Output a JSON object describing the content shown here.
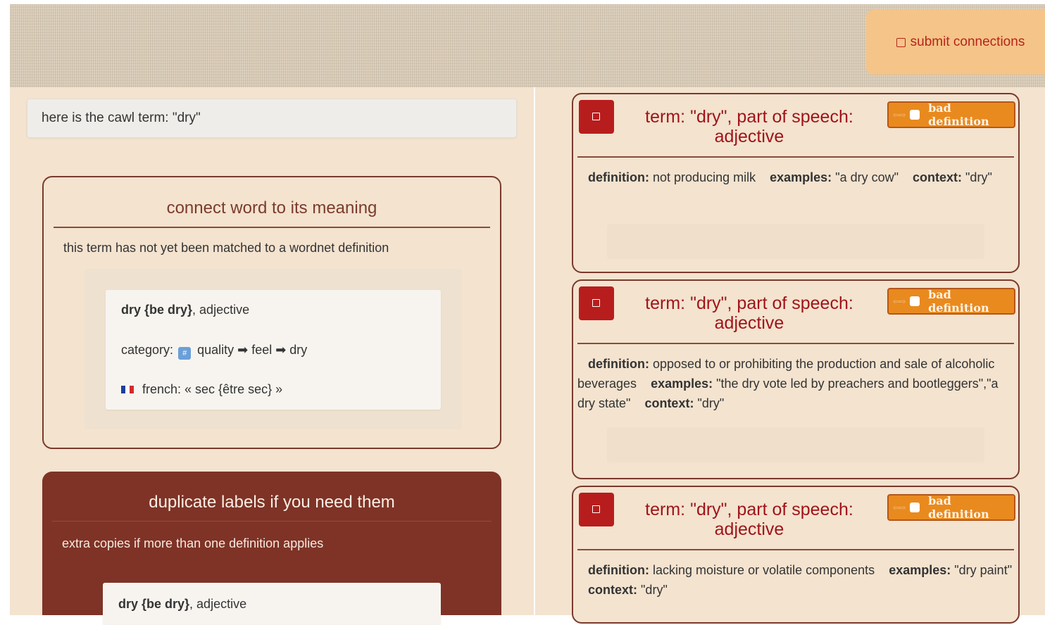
{
  "header": {
    "submit_label": "submit connections"
  },
  "term_well": {
    "text": "here is the cawl term: \"dry\""
  },
  "connect": {
    "title": "connect word to its meaning",
    "note": "this term has not yet been matched to a wordnet definition"
  },
  "label_card": {
    "word": "dry {be dry}",
    "pos": ", adjective",
    "category_label": "category:",
    "category_icon": "#",
    "category_path": "quality ➡ feel ➡ dry",
    "french": "french: « sec {être sec} »"
  },
  "duplicate": {
    "title": "duplicate labels if you need them",
    "note": "extra copies if more than one definition applies",
    "card_word": "dry {be dry}",
    "card_pos": ", adjective"
  },
  "senses": [
    {
      "head_line1": "term: \"dry\", part of speech:",
      "head_line2": "adjective",
      "bad_label": "bad definition",
      "definition_label": "definition:",
      "definition": "not producing milk",
      "examples_label": "examples:",
      "examples": "\"a dry cow\"",
      "context_label": "context:",
      "context": "\"dry\""
    },
    {
      "head_line1": "term: \"dry\", part of speech:",
      "head_line2": "adjective",
      "bad_label": "bad definition",
      "definition_label": "definition:",
      "definition": "opposed to or prohibiting the production and sale of alcoholic beverages",
      "examples_label": "examples:",
      "examples": "\"the dry vote led by preachers and bootleggers\",\"a dry state\"",
      "context_label": "context:",
      "context": "\"dry\""
    },
    {
      "head_line1": "term: \"dry\", part of speech:",
      "head_line2": "adjective",
      "bad_label": "bad definition",
      "definition_label": "definition:",
      "definition": "lacking moisture or volatile components",
      "examples_label": "examples:",
      "examples": "\"dry paint\"",
      "context_label": "context:",
      "context": "\"dry\""
    }
  ],
  "colors": {
    "accent_red": "#b81d1d",
    "heading_red": "#a0141a",
    "orange_button": "#e98a1e",
    "submit_bg": "#f5c488",
    "panel_bg": "#f3e3cf",
    "dup_bg": "#7e3326"
  }
}
